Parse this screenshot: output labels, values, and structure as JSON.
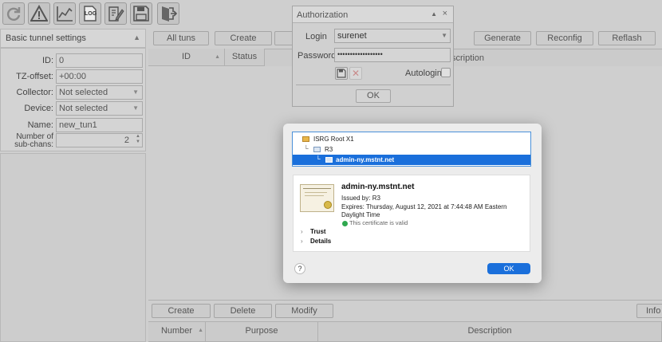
{
  "toolbar": {
    "icons": [
      "refresh-icon",
      "warning-icon",
      "chart-icon",
      "log-icon",
      "edit-icon",
      "save-icon",
      "exit-icon"
    ],
    "log_label": "LOG"
  },
  "left_panel": {
    "title": "Basic tunnel settings",
    "fields": {
      "id": {
        "label": "ID:",
        "value": "0"
      },
      "tz": {
        "label": "TZ-offset:",
        "value": "+00:00"
      },
      "collector": {
        "label": "Collector:",
        "value": "Not selected"
      },
      "device": {
        "label": "Device:",
        "value": "Not selected"
      },
      "name": {
        "label": "Name:",
        "value": "new_tun1"
      },
      "subchans": {
        "label_line1": "Number of",
        "label_line2": "sub-chans:",
        "value": "2"
      }
    }
  },
  "top_toolbar": {
    "all_tuns": "All tuns",
    "create": "Create",
    "generate": "Generate",
    "reconfig": "Reconfig",
    "reflash": "Reflash"
  },
  "top_table": {
    "columns": {
      "id": "ID",
      "status": "Status",
      "description": "Description"
    },
    "description_visible": "scription"
  },
  "bottom_toolbar": {
    "create": "Create",
    "delete": "Delete",
    "modify": "Modify",
    "info": "Info"
  },
  "bottom_table": {
    "columns": {
      "number": "Number",
      "purpose": "Purpose",
      "description": "Description"
    }
  },
  "auth_dialog": {
    "title": "Authorization",
    "login_label": "Login",
    "login_value": "surenet",
    "password_label": "Password",
    "password_value": "••••••••••••••••••",
    "autologin_label": "Autologin",
    "ok_label": "OK"
  },
  "cert_dialog": {
    "chain": [
      "ISRG Root X1",
      "R3",
      "admin-ny.mstnt.net"
    ],
    "subject": "admin-ny.mstnt.net",
    "issued_by": "Issued by: R3",
    "expires_line1": "Expires: Thursday, August 12, 2021 at 7:44:48 AM Eastern",
    "expires_line2": "Daylight Time",
    "valid_text": "This certificate is valid",
    "trust_label": "Trust",
    "details_label": "Details",
    "help_label": "?",
    "ok_label": "OK",
    "accent_color": "#1a6fdb",
    "valid_color": "#2fa84f"
  }
}
